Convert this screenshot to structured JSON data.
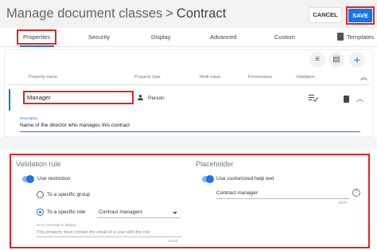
{
  "header": {
    "title": "Manage document classes",
    "separator": ">",
    "current": "Contract",
    "cancel_label": "CANCEL",
    "save_label": "SAVE"
  },
  "tabs": [
    {
      "label": "Properties",
      "active": true
    },
    {
      "label": "Security"
    },
    {
      "label": "Display"
    },
    {
      "label": "Advanced"
    },
    {
      "label": "Custom"
    },
    {
      "label": "Templates"
    }
  ],
  "toolbar_icons": [
    "list-icon",
    "table-icon",
    "add-icon",
    "chevron-up-icon"
  ],
  "columns": [
    "Property name",
    "Property type",
    "Multi-value",
    "Permissions",
    "Validation"
  ],
  "property": {
    "name": "Manager",
    "type": "Person",
    "description_label": "Description",
    "description": "Name of the director who manages this contract"
  },
  "validation": {
    "title": "Validation rule",
    "use_restriction_label": "Use restriction",
    "use_restriction_on": true,
    "option_group_label": "To a specific group",
    "option_role_label": "To a specific role",
    "selected_option": "role",
    "role_value": "Contract managers",
    "error_label": "Error message to display",
    "error_text": "This property must contain the email of a user with the role",
    "error_counter": "0/100"
  },
  "placeholder": {
    "title": "Placeholder",
    "help_toggle_label": "Use customized help text",
    "help_toggle_on": true,
    "help_text": "Contract manager",
    "counter": "16/20"
  },
  "colors": {
    "accent": "#1a73e8",
    "highlight": "#e02424"
  }
}
